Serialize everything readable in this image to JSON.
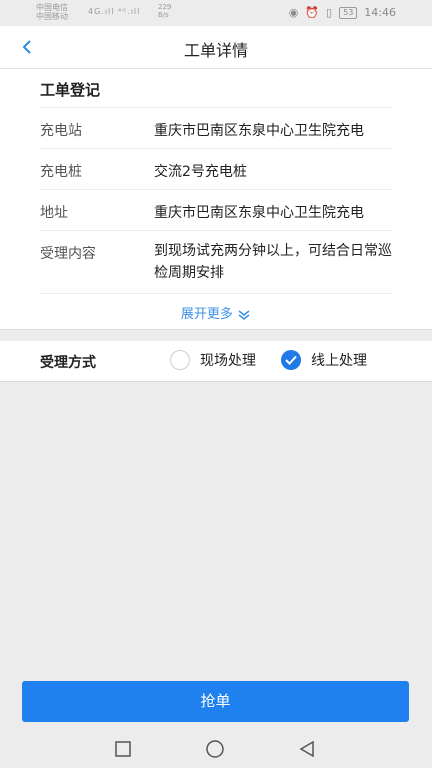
{
  "status_bar": {
    "carrier_1": "中国电信",
    "carrier_2": "中国移动",
    "signal": "4G.ıll ⁴ᴳ.ıll",
    "net_speed": "229\nB/s",
    "battery": "53",
    "time": "14:46"
  },
  "header": {
    "title": "工单详情"
  },
  "card": {
    "section_title": "工单登记",
    "rows": [
      {
        "label": "充电站",
        "value": "重庆市巴南区东泉中心卫生院充电"
      },
      {
        "label": "充电桩",
        "value": "交流2号充电桩"
      },
      {
        "label": "地址",
        "value": "重庆市巴南区东泉中心卫生院充电"
      },
      {
        "label": "受理内容",
        "value": "到现场试充两分钟以上，可结合日常巡检周期安排"
      }
    ],
    "expand_label": "展开更多"
  },
  "method": {
    "label": "受理方式",
    "options": [
      {
        "label": "现场处理",
        "checked": false
      },
      {
        "label": "线上处理",
        "checked": true
      }
    ]
  },
  "actions": {
    "grab_label": "抢单"
  },
  "colors": {
    "accent": "#1f80f0",
    "link": "#3d8fe6"
  }
}
